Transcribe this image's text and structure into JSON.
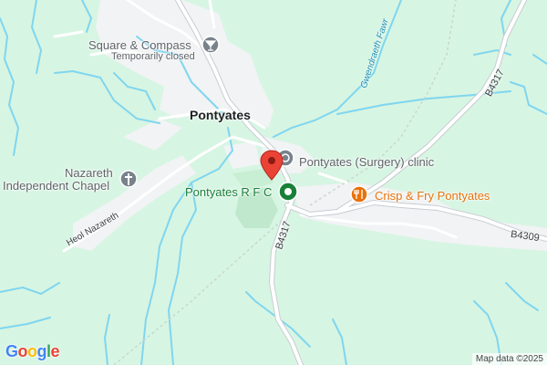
{
  "map": {
    "colors": {
      "land": "#d7f5e3",
      "built_up": "#f1f3f4",
      "park": "#bfe8cc",
      "water": "#7fd6ef",
      "road": "#ffffff",
      "road_outline": "#c8cdd2",
      "pin": "#ea4335",
      "poi_green": "#188038",
      "poi_orange": "#e8710a",
      "poi_gray": "#78828b"
    },
    "places": {
      "town": "Pontyates"
    },
    "pois": {
      "square_compass": {
        "name": "Square & Compass",
        "status": "Temporarily closed",
        "icon": "cocktail-icon"
      },
      "chapel": {
        "name_line1": "Nazareth",
        "name_line2": "Independent Chapel",
        "icon": "cross-icon"
      },
      "clinic": {
        "name": "Pontyates (Surgery) clinic",
        "icon": "medical-icon"
      },
      "rfc": {
        "name": "Pontyates R F C",
        "icon": "sports-ground-icon"
      },
      "restaurant": {
        "name": "Crisp & Fry Pontyates",
        "icon": "restaurant-icon"
      }
    },
    "roads": {
      "b4317_north": "B4317",
      "b4317_south": "B4317",
      "b4309": "B4309",
      "heol_nazareth": "Heol Nazareth"
    },
    "water": {
      "gwendraeth_fawr": "Gwendraeth Fawr"
    },
    "attribution": "Map data ©2025",
    "logo": [
      "G",
      "o",
      "o",
      "g",
      "l",
      "e"
    ]
  }
}
